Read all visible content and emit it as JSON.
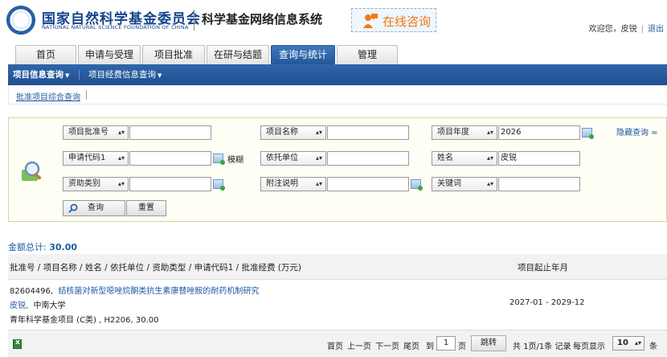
{
  "header": {
    "org_cn": "国家自然科学基金委员会",
    "org_en": "NATIONAL NATURAL SCIENCE FOUNDATION OF CHINA",
    "system_title": "科学基金网络信息系统",
    "consult_label": "在线咨询",
    "welcome": "欢迎您，皮锐",
    "logout": "退出"
  },
  "tabs": [
    {
      "label": "首页"
    },
    {
      "label": "申请与受理"
    },
    {
      "label": "项目批准"
    },
    {
      "label": "在研与结题"
    },
    {
      "label": "查询与统计",
      "active": true
    },
    {
      "label": "管理"
    }
  ],
  "nav": {
    "items": [
      {
        "label": "项目信息查询",
        "active": true
      },
      {
        "label": "项目经费信息查询"
      }
    ],
    "caret": "▼"
  },
  "subnav": {
    "items": [
      {
        "label": "批准项目综合查询"
      }
    ]
  },
  "search": {
    "hide_label": "隐藏查询 ≈",
    "fuzzy_label": "模糊",
    "row1": [
      {
        "field": "项目批准号",
        "value": ""
      },
      {
        "field": "项目名称",
        "value": ""
      },
      {
        "field": "项目年度",
        "value": "2026"
      }
    ],
    "row2": [
      {
        "field": "申请代码1",
        "value": ""
      },
      {
        "field": "依托单位",
        "value": ""
      },
      {
        "field": "姓名",
        "value": "皮锐"
      }
    ],
    "row3": [
      {
        "field": "资助类别",
        "value": ""
      },
      {
        "field": "附注说明",
        "value": ""
      },
      {
        "field": "关键词",
        "value": ""
      }
    ],
    "query_button": "查询",
    "reset_button": "重置"
  },
  "results": {
    "total_label": "金额总计: ",
    "total_value": "30.00",
    "header_main": "批准号 / 项目名称 / 姓名 / 依托单位 / 资助类型 / 申请代码1 / 批准经费  (万元)",
    "header_date": "项目起止年月",
    "rows": [
      {
        "id": "82604496,",
        "title": "结核菌对新型噁唑烷酮类抗生素康替唑胺的耐药机制研究",
        "person": "皮锐,",
        "institution": "中南大学",
        "detail": "青年科学基金项目 (C类) , H2206, 30.00",
        "dates": "2027-01 - 2029-12"
      }
    ]
  },
  "pager": {
    "first": "首页",
    "prev": "上一页",
    "next": "下一页",
    "last": "尾页",
    "goto_prefix": "到",
    "page_value": "1",
    "goto_suffix": "页",
    "jump_button": "跳转",
    "summary": "共 1页/1条 记录",
    "per_page_label": "每页显示",
    "per_page_value": "10",
    "per_page_suffix": "条"
  },
  "colors": {
    "brand_blue": "#1e5aa0",
    "nav_blue": "#24579a",
    "consult_orange": "#f07a12",
    "panel_bg": "#fffef5"
  }
}
